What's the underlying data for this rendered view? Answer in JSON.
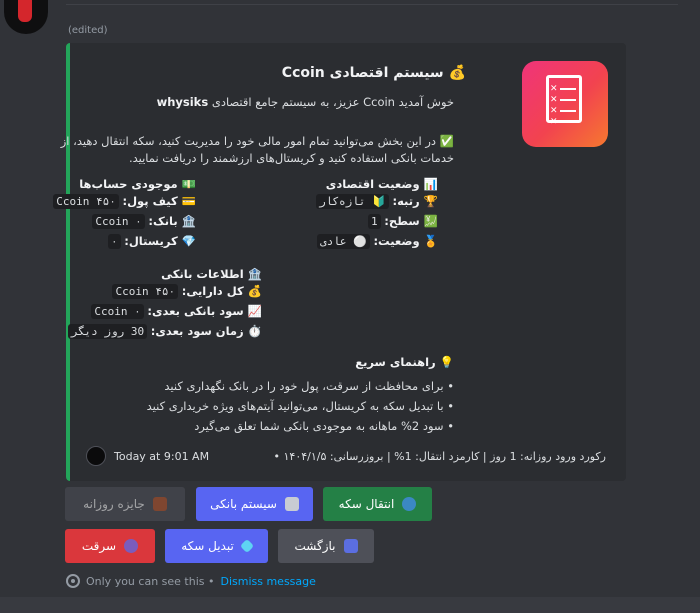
{
  "message": {
    "edited_label": "(edited)"
  },
  "embed": {
    "title": "💰 سیستم اقتصادی Ccoin",
    "intro_user": "whysiks",
    "intro_text": "خوش آمدید Ccoin عزیز، به سیستم جامع اقتصادی",
    "desc_line1": "✅ در این بخش می‌توانید تمام امور مالی خود را مدیریت کنید، سکه انتقال دهید، از",
    "desc_line2": "خدمات بانکی استفاده کنید و کریستال‌های ارزشمند را دریافت نمایید.",
    "fields": {
      "balances": {
        "name": "💵 موجودی حساب‌ها",
        "wallet_label": "💳 کیف پول:",
        "wallet_value": "Ccoin ۴۵۰",
        "bank_label": "🏦 بانک:",
        "bank_value": "Ccoin ۰",
        "crystal_label": "💎 کریستال:",
        "crystal_value": "۰"
      },
      "status": {
        "name": "📊 وضعیت اقتصادی",
        "rank_label": "🏆 رتبه:",
        "rank_value": "🔰 تازه‌کار",
        "level_label": "💹 سطح:",
        "level_value": "1",
        "state_label": "🏅 وضعیت:",
        "state_value": "⚪ عادی"
      },
      "bank_info": {
        "name": "🏦 اطلاعات بانکی",
        "total_label": "💰 کل دارایی:",
        "total_value": "Ccoin ۴۵۰",
        "profit_label": "📈 سود بانکی بعدی:",
        "profit_value": "Ccoin ۰",
        "time_label": "⏱️ زمان سود بعدی:",
        "time_value": "30 روز دیگر"
      },
      "guide": {
        "name": "💡 راهنمای سریع",
        "tip1": "• برای محافظت از سرقت، پول خود را در بانک نگهداری کنید",
        "tip2": "• با تبدیل سکه به کریستال، می‌توانید آیتم‌های ویژه خریداری کنید",
        "tip3": "• سود 2% ماهانه به موجودی بانکی شما تعلق می‌گیرد"
      }
    },
    "footer_text": "رکورد ورود روزانه: 1 روز | کارمزد انتقال: 1% | بروزرسانی: ۱۴۰۴/۱/۵ •",
    "footer_time": "Today at 9:01 AM"
  },
  "buttons": {
    "daily_reward": "جایزه روزانه",
    "banking_system": "سیستم بانکی",
    "coin_transfer": "انتقال سکه",
    "back": "بازگشت",
    "convert_coin": "تبدیل سکه",
    "robbery": "سرقت"
  },
  "ephemeral": {
    "only_you": "Only you can see this •",
    "dismiss": "Dismiss message"
  },
  "colors": {
    "embed_accent": "#23a55a",
    "blurple": "#5865f2",
    "green": "#248046",
    "red": "#da373c",
    "grey": "#4e5058",
    "link": "#00a8fc"
  }
}
